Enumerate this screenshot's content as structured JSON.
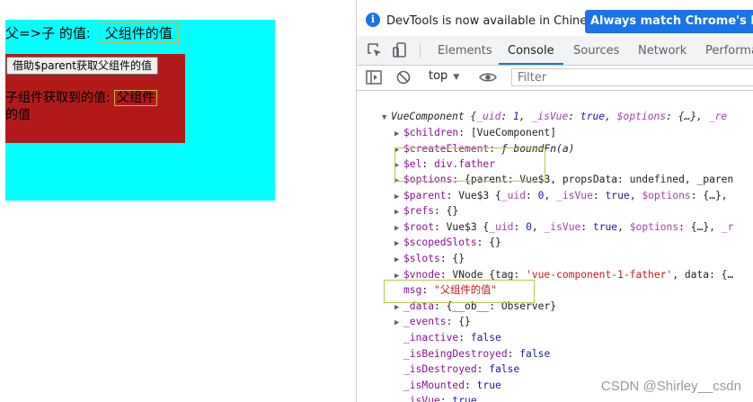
{
  "page": {
    "father_label": "父=>子 的值:",
    "father_value": "父组件的值",
    "child_button": "借助$parent获取父组件的值",
    "child_label": "子组件获取到的值:",
    "child_value": "父组件",
    "child_value_tail": "的值",
    "colors": {
      "father_bg": "#00ffff",
      "child_bg": "#b21a1a"
    }
  },
  "devtools": {
    "info_text": "DevTools is now available in Chinese!",
    "match_button": "Always match Chrome's langua",
    "tabs": [
      "Elements",
      "Console",
      "Sources",
      "Network",
      "Performa"
    ],
    "active_tab": "Console",
    "context": "top",
    "filter_placeholder": "Filter",
    "icons": [
      "info-icon",
      "inspect-icon",
      "device-icon",
      "sidebar-icon",
      "clear-icon",
      "eye-icon"
    ]
  },
  "console": {
    "rows": [
      {
        "arrow": "▼",
        "parts": [
          [
            "ital plain",
            "VueComponent {"
          ],
          [
            "ital key-dim",
            "_uid"
          ],
          [
            "ital plain",
            ": "
          ],
          [
            "ital kw",
            "1"
          ],
          [
            "ital plain",
            ", "
          ],
          [
            "ital key-dim",
            "_isVue"
          ],
          [
            "ital plain",
            ": "
          ],
          [
            "ital kw",
            "true"
          ],
          [
            "ital plain",
            ", "
          ],
          [
            "ital key-dim",
            "$options"
          ],
          [
            "ital plain",
            ": {…}, "
          ],
          [
            "ital key-dim",
            "_re"
          ]
        ]
      },
      {
        "arrow": "▶",
        "parts": [
          [
            "key",
            "$children"
          ],
          [
            "plain",
            ": [VueComponent]"
          ]
        ]
      },
      {
        "arrow": "▶",
        "parts": [
          [
            "key",
            "$createElement"
          ],
          [
            "plain",
            ": "
          ],
          [
            "ital plain",
            "ƒ boundFn(a)"
          ]
        ]
      },
      {
        "arrow": "▶",
        "parts": [
          [
            "key",
            "$el"
          ],
          [
            "plain",
            ": "
          ],
          [
            "key",
            "div.father"
          ]
        ]
      },
      {
        "arrow": "▶",
        "parts": [
          [
            "key",
            "$options"
          ],
          [
            "plain",
            ": {parent: Vue$3, propsData: undefined, _paren"
          ]
        ]
      },
      {
        "arrow": "▶",
        "parts": [
          [
            "key",
            "$parent"
          ],
          [
            "plain",
            ": Vue$3 {"
          ],
          [
            "key-dim",
            "_uid"
          ],
          [
            "plain",
            ": "
          ],
          [
            "kw",
            "0"
          ],
          [
            "plain",
            ", "
          ],
          [
            "key-dim",
            "_isVue"
          ],
          [
            "plain",
            ": "
          ],
          [
            "kw",
            "true"
          ],
          [
            "plain",
            ", "
          ],
          [
            "key-dim",
            "$options"
          ],
          [
            "plain",
            ": {…}, "
          ]
        ]
      },
      {
        "arrow": "▶",
        "parts": [
          [
            "key",
            "$refs"
          ],
          [
            "plain",
            ": {}"
          ]
        ]
      },
      {
        "arrow": "▶",
        "parts": [
          [
            "key",
            "$root"
          ],
          [
            "plain",
            ": Vue$3 {"
          ],
          [
            "key-dim",
            "_uid"
          ],
          [
            "plain",
            ": "
          ],
          [
            "kw",
            "0"
          ],
          [
            "plain",
            ", "
          ],
          [
            "key-dim",
            "_isVue"
          ],
          [
            "plain",
            ": "
          ],
          [
            "kw",
            "true"
          ],
          [
            "plain",
            ", "
          ],
          [
            "key-dim",
            "$options"
          ],
          [
            "plain",
            ": {…}, "
          ],
          [
            "key-dim",
            "_r"
          ]
        ]
      },
      {
        "arrow": "▶",
        "parts": [
          [
            "key",
            "$scopedSlots"
          ],
          [
            "plain",
            ": {}"
          ]
        ]
      },
      {
        "arrow": "▶",
        "parts": [
          [
            "key",
            "$slots"
          ],
          [
            "plain",
            ": {}"
          ]
        ]
      },
      {
        "arrow": "▶",
        "parts": [
          [
            "key",
            "$vnode"
          ],
          [
            "plain",
            ": VNode {tag: "
          ],
          [
            "str",
            "'vue-component-1-father'"
          ],
          [
            "plain",
            ", data: {…"
          ]
        ]
      },
      {
        "arrow": "",
        "parts": [
          [
            "key",
            "msg"
          ],
          [
            "plain",
            ": "
          ],
          [
            "str",
            "\"父组件的值\""
          ]
        ]
      },
      {
        "arrow": "▶",
        "parts": [
          [
            "key",
            "_data"
          ],
          [
            "plain",
            ": {__ob__: Observer}"
          ]
        ]
      },
      {
        "arrow": "▶",
        "parts": [
          [
            "key",
            "_events"
          ],
          [
            "plain",
            ": {}"
          ]
        ]
      },
      {
        "arrow": "",
        "parts": [
          [
            "key",
            "_inactive"
          ],
          [
            "plain",
            ": "
          ],
          [
            "kw",
            "false"
          ]
        ]
      },
      {
        "arrow": "",
        "parts": [
          [
            "key",
            "_isBeingDestroyed"
          ],
          [
            "plain",
            ": "
          ],
          [
            "kw",
            "false"
          ]
        ]
      },
      {
        "arrow": "",
        "parts": [
          [
            "key",
            "_isDestroyed"
          ],
          [
            "plain",
            ": "
          ],
          [
            "kw",
            "false"
          ]
        ]
      },
      {
        "arrow": "",
        "parts": [
          [
            "key",
            "_isMounted"
          ],
          [
            "plain",
            ": "
          ],
          [
            "kw",
            "true"
          ]
        ]
      },
      {
        "arrow": "",
        "parts": [
          [
            "key",
            "_isVue"
          ],
          [
            "plain",
            ": "
          ],
          [
            "kw",
            "true"
          ]
        ]
      }
    ]
  },
  "watermark": "CSDN @Shirley__csdn"
}
